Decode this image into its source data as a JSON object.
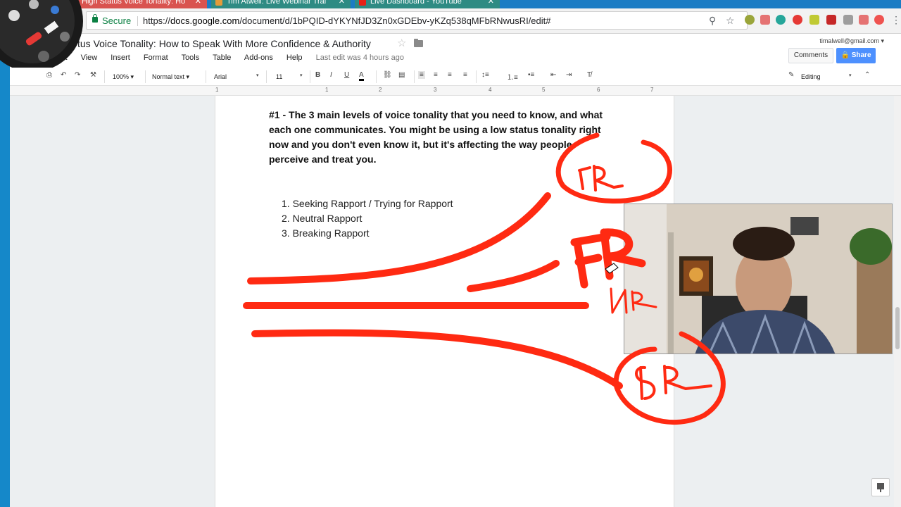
{
  "browser": {
    "tabs": [
      {
        "label": "High Status Voice Tonality: Ho"
      },
      {
        "label": "Tim Atwell: Live Webinar Trai"
      },
      {
        "label": "Live Dashboard - YouTube"
      }
    ],
    "secure_label": "Secure",
    "url_prefix": "https://",
    "url_domain": "docs.google.com",
    "url_path": "/document/d/1bPQID-dYKYNfJD3Zn0xGDEbv-yKZq538qMFbRNwusRI/edit#"
  },
  "doc": {
    "title": "tus Voice Tonality: How to Speak With More Confidence & Authority",
    "menu": [
      "View",
      "Insert",
      "Format",
      "Tools",
      "Table",
      "Add-ons",
      "Help"
    ],
    "menu_partial": "it",
    "last_edit": "Last edit was 4 hours ago",
    "user_email": "timalwell@gmail.com",
    "comments_label": "Comments",
    "share_label": "Share"
  },
  "toolbar": {
    "zoom": "100%",
    "style": "Normal text",
    "font": "Arial",
    "size": "11",
    "mode": "Editing"
  },
  "ruler": [
    "1",
    "1",
    "2",
    "3",
    "4",
    "5",
    "6",
    "7"
  ],
  "content": {
    "heading": "#1 - The 3 main levels of voice tonality that you need to know, and what each one communicates. You might be using a low status tonality right now and you don't even know it, but it's affecting the way people perceive and treat you.",
    "list": [
      "1.  Seeking Rapport / Trying for Rapport",
      "2.  Neutral Rapport",
      "3.  Breaking Rapport"
    ]
  },
  "annotations": {
    "top": "FR",
    "middle": "FR",
    "middle_small": "NR",
    "bottom": "BR",
    "ink_color": "#ff2a12"
  }
}
